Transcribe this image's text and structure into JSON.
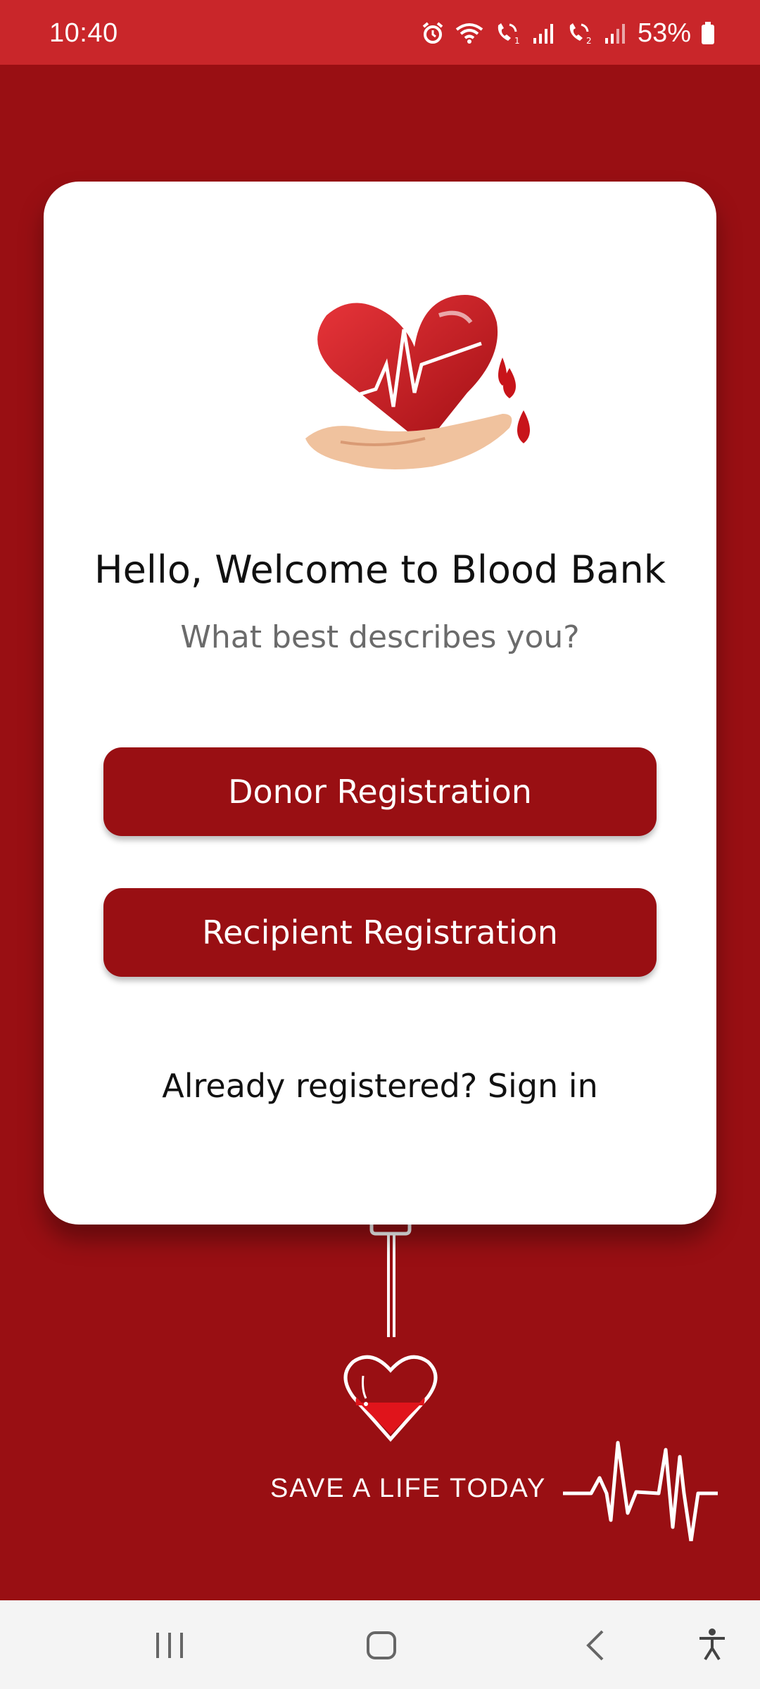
{
  "status_bar": {
    "time": "10:40",
    "battery": "53%",
    "icons": [
      "alarm-icon",
      "wifi-icon",
      "call-sim1-icon",
      "signal-sim1-icon",
      "call-sim2-icon",
      "signal-sim2-icon",
      "battery-icon"
    ]
  },
  "card": {
    "title": "Hello, Welcome to Blood Bank",
    "subtitle": "What best describes you?",
    "donor_button": "Donor Registration",
    "recipient_button": "Recipient Registration",
    "signin_text": "Already registered? Sign in"
  },
  "footer": {
    "tagline": "SAVE A LIFE TODAY"
  },
  "nav_bar": {
    "items": [
      "recents-icon",
      "home-icon",
      "back-icon",
      "accessibility-icon"
    ]
  },
  "colors": {
    "background": "#990f13",
    "status_bar": "#c9262a",
    "card": "#ffffff",
    "button": "#990f13",
    "nav_bar": "#f4f4f4"
  }
}
